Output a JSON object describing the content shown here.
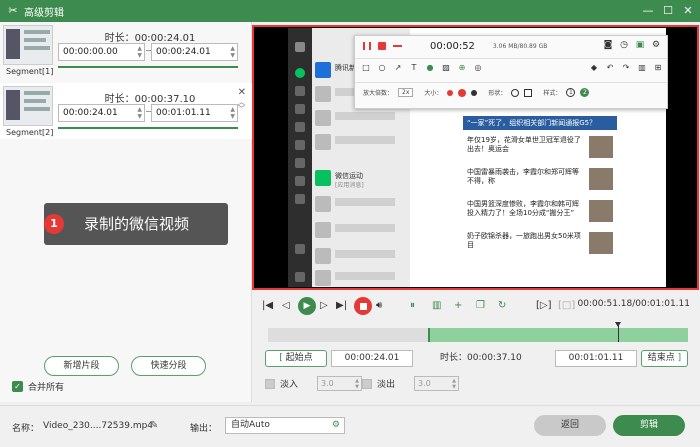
{
  "window": {
    "title": "高级剪辑"
  },
  "segments": [
    {
      "label": "Segment[1]",
      "duration": "时长：00:00:24.01",
      "start": "00:00:00.00",
      "end": "00:00:24.01"
    },
    {
      "label": "Segment[2]",
      "duration": "时长：00:00:37.10",
      "start": "00:00:24.01",
      "end": "00:01:01.11"
    }
  ],
  "left": {
    "add_segment": "新增片段",
    "quick_split": "快速分段",
    "merge_all": "合并所有"
  },
  "recorder": {
    "time": "00:00:52",
    "info": "3.06 MB/80.89 GB",
    "zoom_label": "放大倍数：",
    "zoom_value": "2x",
    "size_label": "大小：",
    "shape_label": "形状：",
    "style_label": "样式：",
    "style_1": "1",
    "style_2": "2"
  },
  "wechat": {
    "chats": [
      {
        "title": "腾讯新闻"
      },
      {
        "title": ""
      },
      {
        "title": ""
      },
      {
        "title": ""
      },
      {
        "title": "微信运动",
        "sub": "[应用消息]"
      },
      {
        "title": ""
      },
      {
        "title": ""
      },
      {
        "title": ""
      },
      {
        "title": ""
      }
    ],
    "article_head": "“一家”死了，组织相关部门新闻通报G5？",
    "news": [
      "年仅19岁，花滑女单世卫冠军退役了出去！奥运会",
      "中国雷暴雨袭击，李霞尔和郑可辉等不得，称",
      "中国男篮深度惨败，李霞尔和韩可辉投入精力了！全场10分成“搬分王”",
      "奶子欧锦杀器，一旅跑出男女50米项目"
    ]
  },
  "tooltip": {
    "number": "1",
    "text": "录制的微信视频"
  },
  "player": {
    "timecode": "00:00:51.18/00:01:01.11",
    "progress": 0.83
  },
  "trim": {
    "start_btn": "起始点",
    "start": "00:00:24.01",
    "duration": "时长：00:00:37.10",
    "end": "00:01:01.11",
    "end_btn": "结束点"
  },
  "fade": {
    "in_label": "淡入",
    "in_value": "3.0",
    "out_label": "淡出",
    "out_value": "3.0"
  },
  "bottom": {
    "name_label": "名称：",
    "filename": "Video_230....72539.mp4",
    "output_label": "输出：",
    "output_value": "自动Auto",
    "back": "返回",
    "cut": "剪辑"
  },
  "colors": {
    "accent": "#3d8b4e",
    "highlight": "#e53935"
  }
}
